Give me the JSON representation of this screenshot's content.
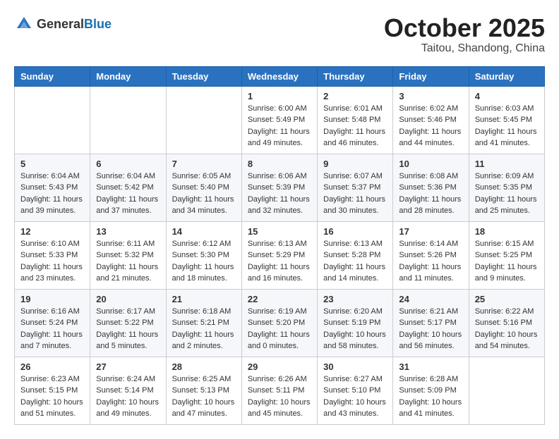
{
  "header": {
    "logo_general": "General",
    "logo_blue": "Blue",
    "month": "October 2025",
    "location": "Taitou, Shandong, China"
  },
  "weekdays": [
    "Sunday",
    "Monday",
    "Tuesday",
    "Wednesday",
    "Thursday",
    "Friday",
    "Saturday"
  ],
  "weeks": [
    [
      {
        "day": "",
        "info": ""
      },
      {
        "day": "",
        "info": ""
      },
      {
        "day": "",
        "info": ""
      },
      {
        "day": "1",
        "info": "Sunrise: 6:00 AM\nSunset: 5:49 PM\nDaylight: 11 hours\nand 49 minutes."
      },
      {
        "day": "2",
        "info": "Sunrise: 6:01 AM\nSunset: 5:48 PM\nDaylight: 11 hours\nand 46 minutes."
      },
      {
        "day": "3",
        "info": "Sunrise: 6:02 AM\nSunset: 5:46 PM\nDaylight: 11 hours\nand 44 minutes."
      },
      {
        "day": "4",
        "info": "Sunrise: 6:03 AM\nSunset: 5:45 PM\nDaylight: 11 hours\nand 41 minutes."
      }
    ],
    [
      {
        "day": "5",
        "info": "Sunrise: 6:04 AM\nSunset: 5:43 PM\nDaylight: 11 hours\nand 39 minutes."
      },
      {
        "day": "6",
        "info": "Sunrise: 6:04 AM\nSunset: 5:42 PM\nDaylight: 11 hours\nand 37 minutes."
      },
      {
        "day": "7",
        "info": "Sunrise: 6:05 AM\nSunset: 5:40 PM\nDaylight: 11 hours\nand 34 minutes."
      },
      {
        "day": "8",
        "info": "Sunrise: 6:06 AM\nSunset: 5:39 PM\nDaylight: 11 hours\nand 32 minutes."
      },
      {
        "day": "9",
        "info": "Sunrise: 6:07 AM\nSunset: 5:37 PM\nDaylight: 11 hours\nand 30 minutes."
      },
      {
        "day": "10",
        "info": "Sunrise: 6:08 AM\nSunset: 5:36 PM\nDaylight: 11 hours\nand 28 minutes."
      },
      {
        "day": "11",
        "info": "Sunrise: 6:09 AM\nSunset: 5:35 PM\nDaylight: 11 hours\nand 25 minutes."
      }
    ],
    [
      {
        "day": "12",
        "info": "Sunrise: 6:10 AM\nSunset: 5:33 PM\nDaylight: 11 hours\nand 23 minutes."
      },
      {
        "day": "13",
        "info": "Sunrise: 6:11 AM\nSunset: 5:32 PM\nDaylight: 11 hours\nand 21 minutes."
      },
      {
        "day": "14",
        "info": "Sunrise: 6:12 AM\nSunset: 5:30 PM\nDaylight: 11 hours\nand 18 minutes."
      },
      {
        "day": "15",
        "info": "Sunrise: 6:13 AM\nSunset: 5:29 PM\nDaylight: 11 hours\nand 16 minutes."
      },
      {
        "day": "16",
        "info": "Sunrise: 6:13 AM\nSunset: 5:28 PM\nDaylight: 11 hours\nand 14 minutes."
      },
      {
        "day": "17",
        "info": "Sunrise: 6:14 AM\nSunset: 5:26 PM\nDaylight: 11 hours\nand 11 minutes."
      },
      {
        "day": "18",
        "info": "Sunrise: 6:15 AM\nSunset: 5:25 PM\nDaylight: 11 hours\nand 9 minutes."
      }
    ],
    [
      {
        "day": "19",
        "info": "Sunrise: 6:16 AM\nSunset: 5:24 PM\nDaylight: 11 hours\nand 7 minutes."
      },
      {
        "day": "20",
        "info": "Sunrise: 6:17 AM\nSunset: 5:22 PM\nDaylight: 11 hours\nand 5 minutes."
      },
      {
        "day": "21",
        "info": "Sunrise: 6:18 AM\nSunset: 5:21 PM\nDaylight: 11 hours\nand 2 minutes."
      },
      {
        "day": "22",
        "info": "Sunrise: 6:19 AM\nSunset: 5:20 PM\nDaylight: 11 hours\nand 0 minutes."
      },
      {
        "day": "23",
        "info": "Sunrise: 6:20 AM\nSunset: 5:19 PM\nDaylight: 10 hours\nand 58 minutes."
      },
      {
        "day": "24",
        "info": "Sunrise: 6:21 AM\nSunset: 5:17 PM\nDaylight: 10 hours\nand 56 minutes."
      },
      {
        "day": "25",
        "info": "Sunrise: 6:22 AM\nSunset: 5:16 PM\nDaylight: 10 hours\nand 54 minutes."
      }
    ],
    [
      {
        "day": "26",
        "info": "Sunrise: 6:23 AM\nSunset: 5:15 PM\nDaylight: 10 hours\nand 51 minutes."
      },
      {
        "day": "27",
        "info": "Sunrise: 6:24 AM\nSunset: 5:14 PM\nDaylight: 10 hours\nand 49 minutes."
      },
      {
        "day": "28",
        "info": "Sunrise: 6:25 AM\nSunset: 5:13 PM\nDaylight: 10 hours\nand 47 minutes."
      },
      {
        "day": "29",
        "info": "Sunrise: 6:26 AM\nSunset: 5:11 PM\nDaylight: 10 hours\nand 45 minutes."
      },
      {
        "day": "30",
        "info": "Sunrise: 6:27 AM\nSunset: 5:10 PM\nDaylight: 10 hours\nand 43 minutes."
      },
      {
        "day": "31",
        "info": "Sunrise: 6:28 AM\nSunset: 5:09 PM\nDaylight: 10 hours\nand 41 minutes."
      },
      {
        "day": "",
        "info": ""
      }
    ]
  ]
}
